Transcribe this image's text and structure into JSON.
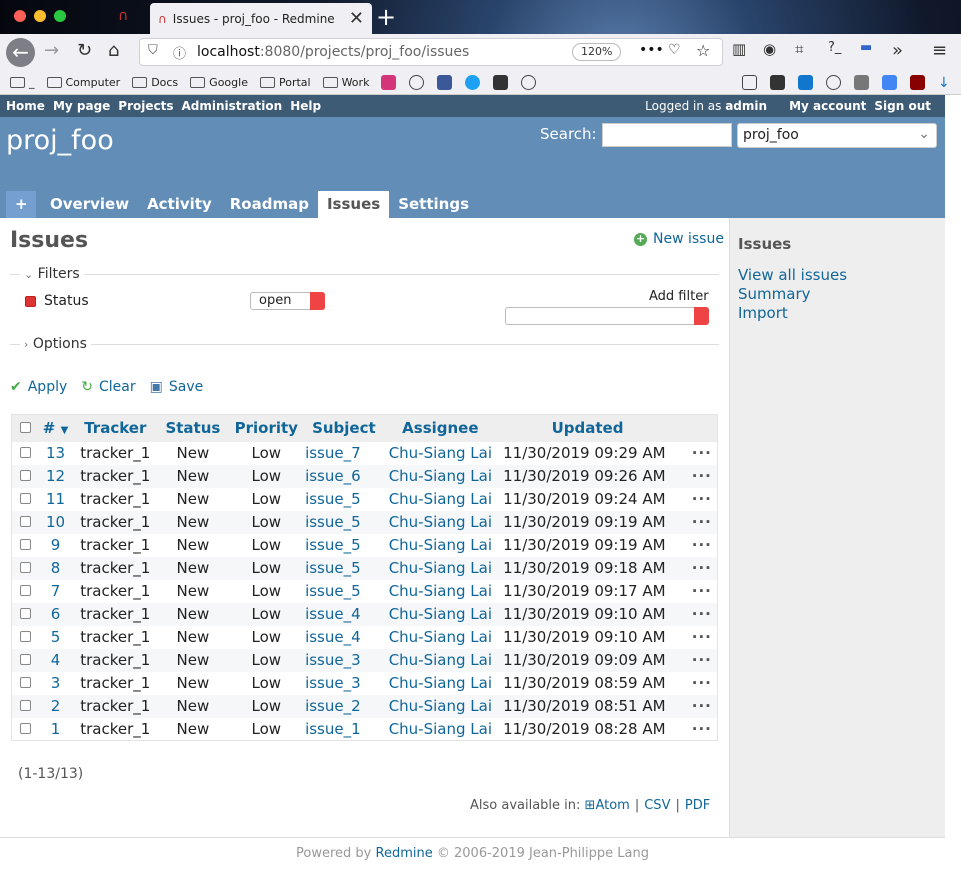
{
  "browser": {
    "tab_title": "Issues - proj_foo - Redmine",
    "url_host": "localhost",
    "url_path": ":8080/projects/proj_foo/issues",
    "zoom": "120%",
    "bookmarks": [
      "_",
      "Computer",
      "Docs",
      "Google",
      "Portal",
      "Work"
    ]
  },
  "top_menu": {
    "left": [
      "Home",
      "My page",
      "Projects",
      "Administration",
      "Help"
    ],
    "logged_in_as": "Logged in as",
    "user": "admin",
    "my_account": "My account",
    "sign_out": "Sign out"
  },
  "header": {
    "project_title": "proj_foo",
    "search_label": "Search:",
    "search_value": "",
    "project_select": "proj_foo",
    "tabs": [
      "+",
      "Overview",
      "Activity",
      "Roadmap",
      "Issues",
      "Settings"
    ],
    "active_tab": "Issues"
  },
  "content": {
    "title": "Issues",
    "new_issue": "New issue",
    "filters_legend": "Filters",
    "status_label": "Status",
    "status_operator": "open",
    "add_filter": "Add filter",
    "options_legend": "Options",
    "apply": "Apply",
    "clear": "Clear",
    "save": "Save",
    "columns": [
      "#",
      "Tracker",
      "Status",
      "Priority",
      "Subject",
      "Assignee",
      "Updated"
    ],
    "rows": [
      {
        "id": "13",
        "tracker": "tracker_1",
        "status": "New",
        "priority": "Low",
        "subject": "issue_7",
        "assignee": "Chu-Siang Lai",
        "updated": "11/30/2019 09:29 AM"
      },
      {
        "id": "12",
        "tracker": "tracker_1",
        "status": "New",
        "priority": "Low",
        "subject": "issue_6",
        "assignee": "Chu-Siang Lai",
        "updated": "11/30/2019 09:26 AM"
      },
      {
        "id": "11",
        "tracker": "tracker_1",
        "status": "New",
        "priority": "Low",
        "subject": "issue_5",
        "assignee": "Chu-Siang Lai",
        "updated": "11/30/2019 09:24 AM"
      },
      {
        "id": "10",
        "tracker": "tracker_1",
        "status": "New",
        "priority": "Low",
        "subject": "issue_5",
        "assignee": "Chu-Siang Lai",
        "updated": "11/30/2019 09:19 AM"
      },
      {
        "id": "9",
        "tracker": "tracker_1",
        "status": "New",
        "priority": "Low",
        "subject": "issue_5",
        "assignee": "Chu-Siang Lai",
        "updated": "11/30/2019 09:19 AM"
      },
      {
        "id": "8",
        "tracker": "tracker_1",
        "status": "New",
        "priority": "Low",
        "subject": "issue_5",
        "assignee": "Chu-Siang Lai",
        "updated": "11/30/2019 09:18 AM"
      },
      {
        "id": "7",
        "tracker": "tracker_1",
        "status": "New",
        "priority": "Low",
        "subject": "issue_5",
        "assignee": "Chu-Siang Lai",
        "updated": "11/30/2019 09:17 AM"
      },
      {
        "id": "6",
        "tracker": "tracker_1",
        "status": "New",
        "priority": "Low",
        "subject": "issue_4",
        "assignee": "Chu-Siang Lai",
        "updated": "11/30/2019 09:10 AM"
      },
      {
        "id": "5",
        "tracker": "tracker_1",
        "status": "New",
        "priority": "Low",
        "subject": "issue_4",
        "assignee": "Chu-Siang Lai",
        "updated": "11/30/2019 09:10 AM"
      },
      {
        "id": "4",
        "tracker": "tracker_1",
        "status": "New",
        "priority": "Low",
        "subject": "issue_3",
        "assignee": "Chu-Siang Lai",
        "updated": "11/30/2019 09:09 AM"
      },
      {
        "id": "3",
        "tracker": "tracker_1",
        "status": "New",
        "priority": "Low",
        "subject": "issue_3",
        "assignee": "Chu-Siang Lai",
        "updated": "11/30/2019 08:59 AM"
      },
      {
        "id": "2",
        "tracker": "tracker_1",
        "status": "New",
        "priority": "Low",
        "subject": "issue_2",
        "assignee": "Chu-Siang Lai",
        "updated": "11/30/2019 08:51 AM"
      },
      {
        "id": "1",
        "tracker": "tracker_1",
        "status": "New",
        "priority": "Low",
        "subject": "issue_1",
        "assignee": "Chu-Siang Lai",
        "updated": "11/30/2019 08:28 AM"
      }
    ],
    "pagination": "(1-13/13)",
    "also_available": "Also available in:",
    "formats": [
      "Atom",
      "CSV",
      "PDF"
    ]
  },
  "sidebar": {
    "title": "Issues",
    "links": [
      "View all issues",
      "Summary",
      "Import"
    ]
  },
  "footer": {
    "powered_by": "Powered by",
    "redmine": "Redmine",
    "copyright": "© 2006-2019 Jean-Philippe Lang"
  }
}
